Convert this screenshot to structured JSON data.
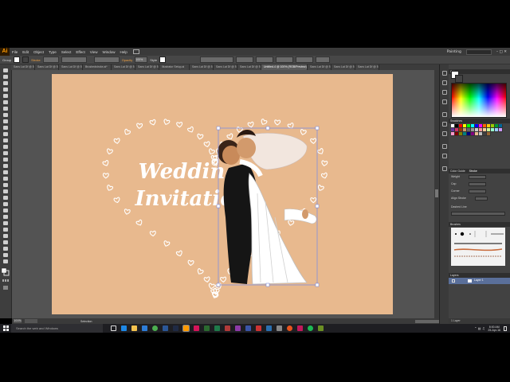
{
  "app": {
    "logo": "Ai",
    "workspace": "Painting"
  },
  "menu": [
    "File",
    "Edit",
    "Object",
    "Type",
    "Select",
    "Effect",
    "View",
    "Window",
    "Help"
  ],
  "control_bar": {
    "selection_label": "Group",
    "stroke_label": "Stroke",
    "opacity_label": "Opacity",
    "opacity_value": "100%",
    "style_label": "Style"
  },
  "tabs": [
    {
      "label": "Sans Lat Df @ 5...",
      "active": false
    },
    {
      "label": "Sans Lat Df @ 5...",
      "active": false
    },
    {
      "label": "Sans Lat Df @ 5...",
      "active": false
    },
    {
      "label": "Brushedstroke.ai*",
      "active": false
    },
    {
      "label": "Sans Lat Df @ 5...",
      "active": false
    },
    {
      "label": "Sans Lat Df @ 5...",
      "active": false
    },
    {
      "label": "Illustrator Setup.ai",
      "active": false
    },
    {
      "label": "Sans Lat Df @ 5...",
      "active": false
    },
    {
      "label": "Sans Lat Df @ 5...",
      "active": false
    },
    {
      "label": "Sans Lat Df @ 5...",
      "active": false
    },
    {
      "label": "Untitled-4 @ 100% (RGB/Preview)",
      "active": true
    },
    {
      "label": "Sans Lat Df @ 5...",
      "active": false
    },
    {
      "label": "Sans Lat Df @ 5...",
      "active": false
    },
    {
      "label": "Sans Lat Df @ 5...",
      "active": false
    }
  ],
  "artwork": {
    "line1": "Wedding",
    "line2": "Invitation"
  },
  "status": {
    "zoom": "100%",
    "tool": "Selection"
  },
  "panels": {
    "color": "Color",
    "swatches": "Swatches",
    "stroke_tabs": [
      "Color Guide",
      "Stroke"
    ],
    "weight_label": "Weight",
    "cap_label": "Cap",
    "corner_label": "Corner",
    "align_label": "Align Stroke",
    "dashed_label": "Dashed Line",
    "brushes": "Brushes",
    "layers": "Layers",
    "layer_name": "Layer 1",
    "layers_count": "1 Layer"
  },
  "swatch_colors": [
    "#ffffff",
    "#000000",
    "#ff0000",
    "#ffff00",
    "#00ff00",
    "#00ffff",
    "#0000ff",
    "#ff00ff",
    "#ff6600",
    "#ffcc00",
    "#99cc00",
    "#009933",
    "#006699",
    "#663399",
    "#cc3366",
    "#993300",
    "#cc9966",
    "#666666",
    "#999999",
    "#cccccc",
    "#ff9999",
    "#ffcc99",
    "#ccff99",
    "#99ffcc",
    "#99ccff",
    "#cc99ff",
    "#ff99cc",
    "#800000",
    "#808000",
    "#008080",
    "#000080",
    "#800080",
    "#e8b98e",
    "#c0c0c0",
    "#404040",
    "#996633"
  ],
  "taskbar": {
    "search_placeholder": "Search the web and Windows",
    "time": "8:00 AM",
    "date": "25-Apr-16"
  },
  "colors": {
    "artboard": "#e8b98e",
    "ui_dark": "#3a3a3a",
    "taskbar": "#1e1e22"
  }
}
